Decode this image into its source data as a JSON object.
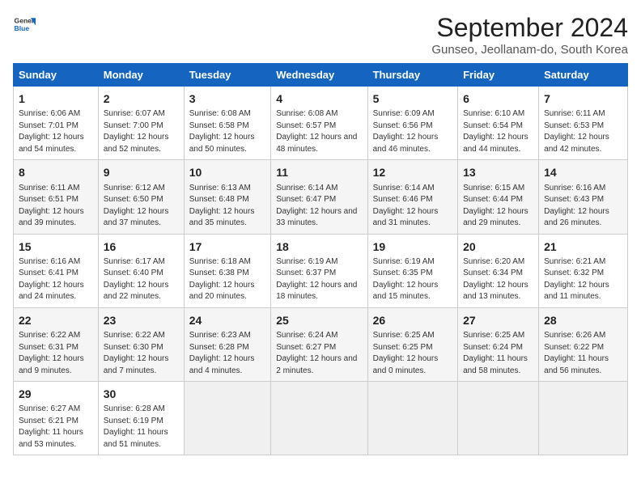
{
  "logo": {
    "line1": "General",
    "line2": "Blue"
  },
  "title": "September 2024",
  "subtitle": "Gunseo, Jeollanam-do, South Korea",
  "days_of_week": [
    "Sunday",
    "Monday",
    "Tuesday",
    "Wednesday",
    "Thursday",
    "Friday",
    "Saturday"
  ],
  "weeks": [
    [
      {
        "day": "1",
        "sunrise": "Sunrise: 6:06 AM",
        "sunset": "Sunset: 7:01 PM",
        "daylight": "Daylight: 12 hours and 54 minutes."
      },
      {
        "day": "2",
        "sunrise": "Sunrise: 6:07 AM",
        "sunset": "Sunset: 7:00 PM",
        "daylight": "Daylight: 12 hours and 52 minutes."
      },
      {
        "day": "3",
        "sunrise": "Sunrise: 6:08 AM",
        "sunset": "Sunset: 6:58 PM",
        "daylight": "Daylight: 12 hours and 50 minutes."
      },
      {
        "day": "4",
        "sunrise": "Sunrise: 6:08 AM",
        "sunset": "Sunset: 6:57 PM",
        "daylight": "Daylight: 12 hours and 48 minutes."
      },
      {
        "day": "5",
        "sunrise": "Sunrise: 6:09 AM",
        "sunset": "Sunset: 6:56 PM",
        "daylight": "Daylight: 12 hours and 46 minutes."
      },
      {
        "day": "6",
        "sunrise": "Sunrise: 6:10 AM",
        "sunset": "Sunset: 6:54 PM",
        "daylight": "Daylight: 12 hours and 44 minutes."
      },
      {
        "day": "7",
        "sunrise": "Sunrise: 6:11 AM",
        "sunset": "Sunset: 6:53 PM",
        "daylight": "Daylight: 12 hours and 42 minutes."
      }
    ],
    [
      {
        "day": "8",
        "sunrise": "Sunrise: 6:11 AM",
        "sunset": "Sunset: 6:51 PM",
        "daylight": "Daylight: 12 hours and 39 minutes."
      },
      {
        "day": "9",
        "sunrise": "Sunrise: 6:12 AM",
        "sunset": "Sunset: 6:50 PM",
        "daylight": "Daylight: 12 hours and 37 minutes."
      },
      {
        "day": "10",
        "sunrise": "Sunrise: 6:13 AM",
        "sunset": "Sunset: 6:48 PM",
        "daylight": "Daylight: 12 hours and 35 minutes."
      },
      {
        "day": "11",
        "sunrise": "Sunrise: 6:14 AM",
        "sunset": "Sunset: 6:47 PM",
        "daylight": "Daylight: 12 hours and 33 minutes."
      },
      {
        "day": "12",
        "sunrise": "Sunrise: 6:14 AM",
        "sunset": "Sunset: 6:46 PM",
        "daylight": "Daylight: 12 hours and 31 minutes."
      },
      {
        "day": "13",
        "sunrise": "Sunrise: 6:15 AM",
        "sunset": "Sunset: 6:44 PM",
        "daylight": "Daylight: 12 hours and 29 minutes."
      },
      {
        "day": "14",
        "sunrise": "Sunrise: 6:16 AM",
        "sunset": "Sunset: 6:43 PM",
        "daylight": "Daylight: 12 hours and 26 minutes."
      }
    ],
    [
      {
        "day": "15",
        "sunrise": "Sunrise: 6:16 AM",
        "sunset": "Sunset: 6:41 PM",
        "daylight": "Daylight: 12 hours and 24 minutes."
      },
      {
        "day": "16",
        "sunrise": "Sunrise: 6:17 AM",
        "sunset": "Sunset: 6:40 PM",
        "daylight": "Daylight: 12 hours and 22 minutes."
      },
      {
        "day": "17",
        "sunrise": "Sunrise: 6:18 AM",
        "sunset": "Sunset: 6:38 PM",
        "daylight": "Daylight: 12 hours and 20 minutes."
      },
      {
        "day": "18",
        "sunrise": "Sunrise: 6:19 AM",
        "sunset": "Sunset: 6:37 PM",
        "daylight": "Daylight: 12 hours and 18 minutes."
      },
      {
        "day": "19",
        "sunrise": "Sunrise: 6:19 AM",
        "sunset": "Sunset: 6:35 PM",
        "daylight": "Daylight: 12 hours and 15 minutes."
      },
      {
        "day": "20",
        "sunrise": "Sunrise: 6:20 AM",
        "sunset": "Sunset: 6:34 PM",
        "daylight": "Daylight: 12 hours and 13 minutes."
      },
      {
        "day": "21",
        "sunrise": "Sunrise: 6:21 AM",
        "sunset": "Sunset: 6:32 PM",
        "daylight": "Daylight: 12 hours and 11 minutes."
      }
    ],
    [
      {
        "day": "22",
        "sunrise": "Sunrise: 6:22 AM",
        "sunset": "Sunset: 6:31 PM",
        "daylight": "Daylight: 12 hours and 9 minutes."
      },
      {
        "day": "23",
        "sunrise": "Sunrise: 6:22 AM",
        "sunset": "Sunset: 6:30 PM",
        "daylight": "Daylight: 12 hours and 7 minutes."
      },
      {
        "day": "24",
        "sunrise": "Sunrise: 6:23 AM",
        "sunset": "Sunset: 6:28 PM",
        "daylight": "Daylight: 12 hours and 4 minutes."
      },
      {
        "day": "25",
        "sunrise": "Sunrise: 6:24 AM",
        "sunset": "Sunset: 6:27 PM",
        "daylight": "Daylight: 12 hours and 2 minutes."
      },
      {
        "day": "26",
        "sunrise": "Sunrise: 6:25 AM",
        "sunset": "Sunset: 6:25 PM",
        "daylight": "Daylight: 12 hours and 0 minutes."
      },
      {
        "day": "27",
        "sunrise": "Sunrise: 6:25 AM",
        "sunset": "Sunset: 6:24 PM",
        "daylight": "Daylight: 11 hours and 58 minutes."
      },
      {
        "day": "28",
        "sunrise": "Sunrise: 6:26 AM",
        "sunset": "Sunset: 6:22 PM",
        "daylight": "Daylight: 11 hours and 56 minutes."
      }
    ],
    [
      {
        "day": "29",
        "sunrise": "Sunrise: 6:27 AM",
        "sunset": "Sunset: 6:21 PM",
        "daylight": "Daylight: 11 hours and 53 minutes."
      },
      {
        "day": "30",
        "sunrise": "Sunrise: 6:28 AM",
        "sunset": "Sunset: 6:19 PM",
        "daylight": "Daylight: 11 hours and 51 minutes."
      },
      null,
      null,
      null,
      null,
      null
    ]
  ]
}
